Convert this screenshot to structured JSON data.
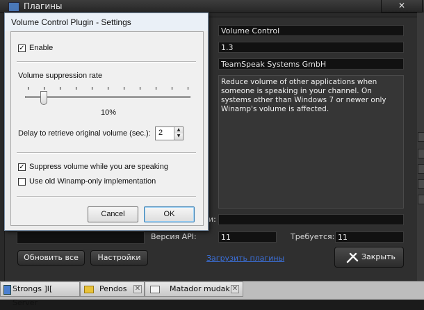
{
  "parent": {
    "title": "Плагины",
    "close_label": "✕",
    "fields": {
      "name": "Volume Control",
      "version": "1.3",
      "author": "TeamSpeak Systems GmbH",
      "description": "Reduce volume of other applications when someone is speaking in your channel. On systems other than Windows 7 or newer only Winamp's volume is affected.",
      "partial_label_fragment": "и:",
      "api_version_label": "Версия API:",
      "api_version_value": "11",
      "required_label": "Требуется:",
      "required_value": "11"
    },
    "buttons": {
      "refresh_all": "Обновить все",
      "settings": "Настройки",
      "load_plugins_link": "Загрузить плагины",
      "close": "Закрыть"
    }
  },
  "taskbar": {
    "tabs": [
      {
        "label": "Strongs ]I[ Server"
      },
      {
        "label": "Pendos"
      },
      {
        "label": "Matador mudak"
      }
    ]
  },
  "dialog": {
    "title": "Volume Control Plugin - Settings",
    "enable_label": "Enable",
    "enable_checked": true,
    "slider_label": "Volume suppression rate",
    "slider_value_text": "10%",
    "slider_value": 10,
    "delay_label": "Delay to retrieve original volume (sec.):",
    "delay_value": "2",
    "suppress_label": "Suppress volume while you are speaking",
    "suppress_checked": true,
    "old_winamp_label": "Use old Winamp-only implementation",
    "old_winamp_checked": false,
    "cancel_label": "Cancel",
    "ok_label": "OK",
    "check_mark": "✓"
  },
  "colors": {
    "dark_bg": "#2a2a2a",
    "dialog_bg": "#f0f0f0",
    "link": "#3b6fd8"
  }
}
